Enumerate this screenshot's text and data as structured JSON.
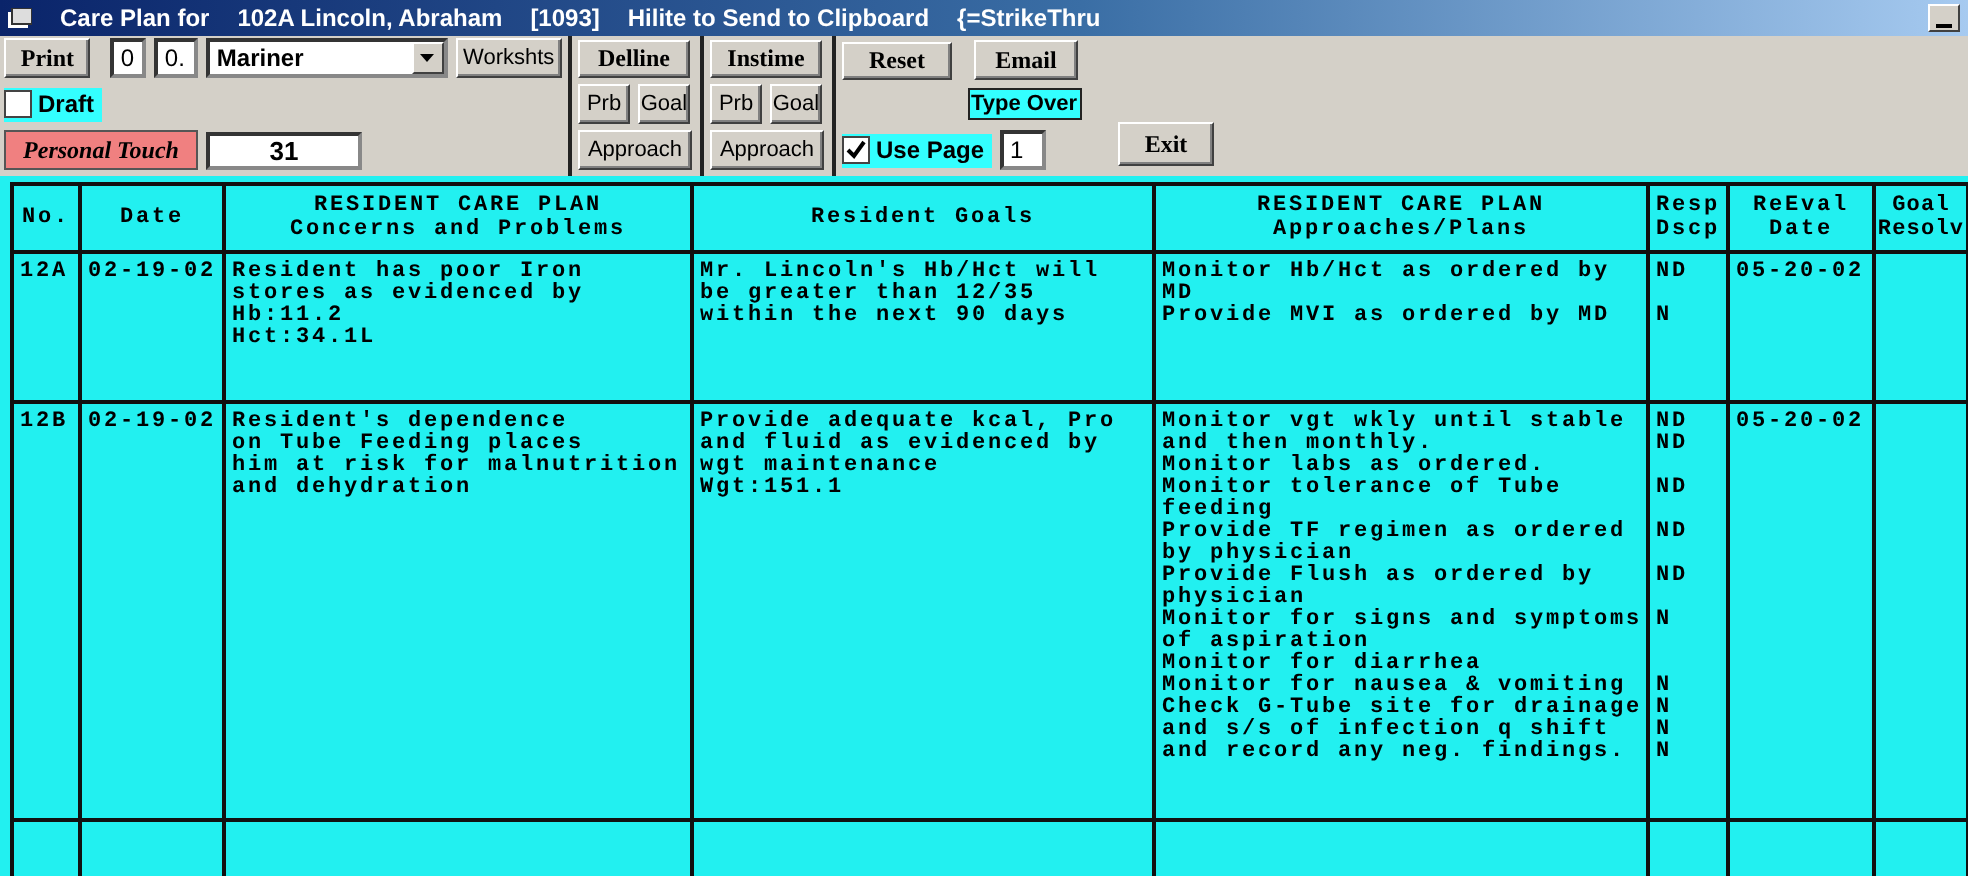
{
  "window": {
    "title_parts": [
      "Care Plan for",
      "102A Lincoln, Abraham",
      "[1093]",
      "Hilite to Send to Clipboard",
      "{=StrikeThru"
    ]
  },
  "toolbar": {
    "print": "Print",
    "field_a": "0",
    "field_b": "0.",
    "combo": "Mariner",
    "worksheets": "Workshts",
    "draft": {
      "label": "Draft",
      "checked": false
    },
    "personal_touch": {
      "label": "Personal Touch",
      "value": "31"
    },
    "groups": [
      {
        "title": "Delline",
        "buttons": [
          "Prb",
          "Goal"
        ],
        "wide": "Approach"
      },
      {
        "title": "Instime",
        "buttons": [
          "Prb",
          "Goal"
        ],
        "wide": "Approach"
      }
    ],
    "reset": "Reset",
    "email": "Email",
    "type_over": "Type Over",
    "use_page": {
      "label": "Use Page",
      "checked": true,
      "value": "1"
    },
    "exit": "Exit"
  },
  "table": {
    "columns": [
      {
        "lines": [
          "No."
        ]
      },
      {
        "lines": [
          "Date"
        ]
      },
      {
        "lines": [
          "RESIDENT CARE PLAN",
          "Concerns and Problems"
        ]
      },
      {
        "lines": [
          "Resident Goals"
        ]
      },
      {
        "lines": [
          "RESIDENT CARE PLAN",
          "Approaches/Plans"
        ]
      },
      {
        "lines": [
          "Resp",
          "Dscp"
        ]
      },
      {
        "lines": [
          "ReEval",
          "Date"
        ]
      },
      {
        "lines": [
          "Goal",
          "Resolv"
        ]
      }
    ],
    "rows": [
      {
        "no": "12A",
        "date": "02-19-02",
        "concerns": [
          "Resident has poor Iron",
          "stores as evidenced by",
          "Hb:11.2",
          "Hct:34.1L"
        ],
        "goals": [
          "Mr. Lincoln's Hb/Hct will",
          "be greater than 12/35",
          "within the next 90 days"
        ],
        "approaches": [
          {
            "text": "Monitor Hb/Hct as ordered by",
            "resp": "ND"
          },
          {
            "text": "MD"
          },
          {
            "text": "Provide MVI as ordered by MD",
            "resp": "N"
          }
        ],
        "reeval": "05-20-02"
      },
      {
        "no": "12B",
        "date": "02-19-02",
        "concerns": [
          "Resident's dependence",
          "on Tube Feeding places",
          "him at risk for malnutrition",
          "and dehydration"
        ],
        "goals": [
          "Provide adequate kcal, Pro",
          "and fluid as evidenced by",
          "wgt maintenance",
          "Wgt:151.1"
        ],
        "approaches": [
          {
            "text": "Monitor vgt wkly until stable",
            "resp": "ND"
          },
          {
            "text": "and then monthly.",
            "resp": "ND"
          },
          {
            "text": "Monitor labs as ordered."
          },
          {
            "text": "Monitor tolerance of Tube",
            "resp": "ND"
          },
          {
            "text": "feeding"
          },
          {
            "text": "Provide TF regimen as ordered",
            "resp": "ND"
          },
          {
            "text": "by physician"
          },
          {
            "text": "Provide Flush as ordered by",
            "resp": "ND"
          },
          {
            "text": "physician"
          },
          {
            "text": "Monitor for signs and symptoms",
            "resp": "N"
          },
          {
            "text": "of aspiration"
          },
          {
            "text": "Monitor for diarrhea"
          },
          {
            "text": "Monitor for nausea & vomiting",
            "resp": "N"
          },
          {
            "text": "Check G-Tube site for drainage",
            "resp": "N"
          },
          {
            "text": "and s/s of infection q shift",
            "resp": "N"
          },
          {
            "text": "and record any neg. findings.",
            "resp": "N"
          }
        ],
        "reeval": "05-20-02"
      }
    ]
  }
}
